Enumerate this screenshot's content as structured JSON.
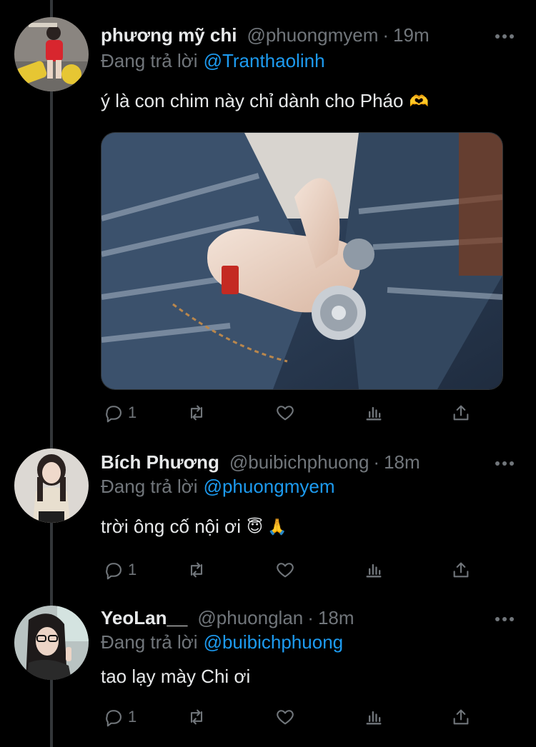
{
  "colors": {
    "background": "#000000",
    "text_primary": "#e7e9ea",
    "text_secondary": "#71767b",
    "accent": "#1d9bf0",
    "thread_line": "#333639"
  },
  "tweets": [
    {
      "name": "phương mỹ chi",
      "handle": "@phuongmyem",
      "time": "19m",
      "reply_prefix": "Đang trả lời",
      "reply_to": "@Tranthaolinh",
      "text": "ý là con chim này chỉ dành cho Pháo",
      "emoji": "🫶",
      "has_media": true,
      "reply_count": "1",
      "retweet_count": "",
      "like_count": ""
    },
    {
      "name": "Bích Phương",
      "handle": "@buibichphuong",
      "time": "18m",
      "reply_prefix": "Đang trả lời",
      "reply_to": "@phuongmyem",
      "text": "trời ông cố nội ơi",
      "emoji": "😇 🙏",
      "has_media": false,
      "reply_count": "1",
      "retweet_count": "",
      "like_count": ""
    },
    {
      "name": "YeoLan__",
      "handle": "@phuonglan",
      "time": "18m",
      "reply_prefix": "Đang trả lời",
      "reply_to": "@buibichphuong",
      "text": "tao lạy mày Chi ơi",
      "emoji": "",
      "has_media": false,
      "reply_count": "1",
      "retweet_count": "",
      "like_count": ""
    }
  ],
  "icons": {
    "reply": "reply-icon",
    "retweet": "retweet-icon",
    "like": "heart-icon",
    "views": "analytics-icon",
    "share": "share-icon",
    "more": "more-icon"
  },
  "separator": "·"
}
